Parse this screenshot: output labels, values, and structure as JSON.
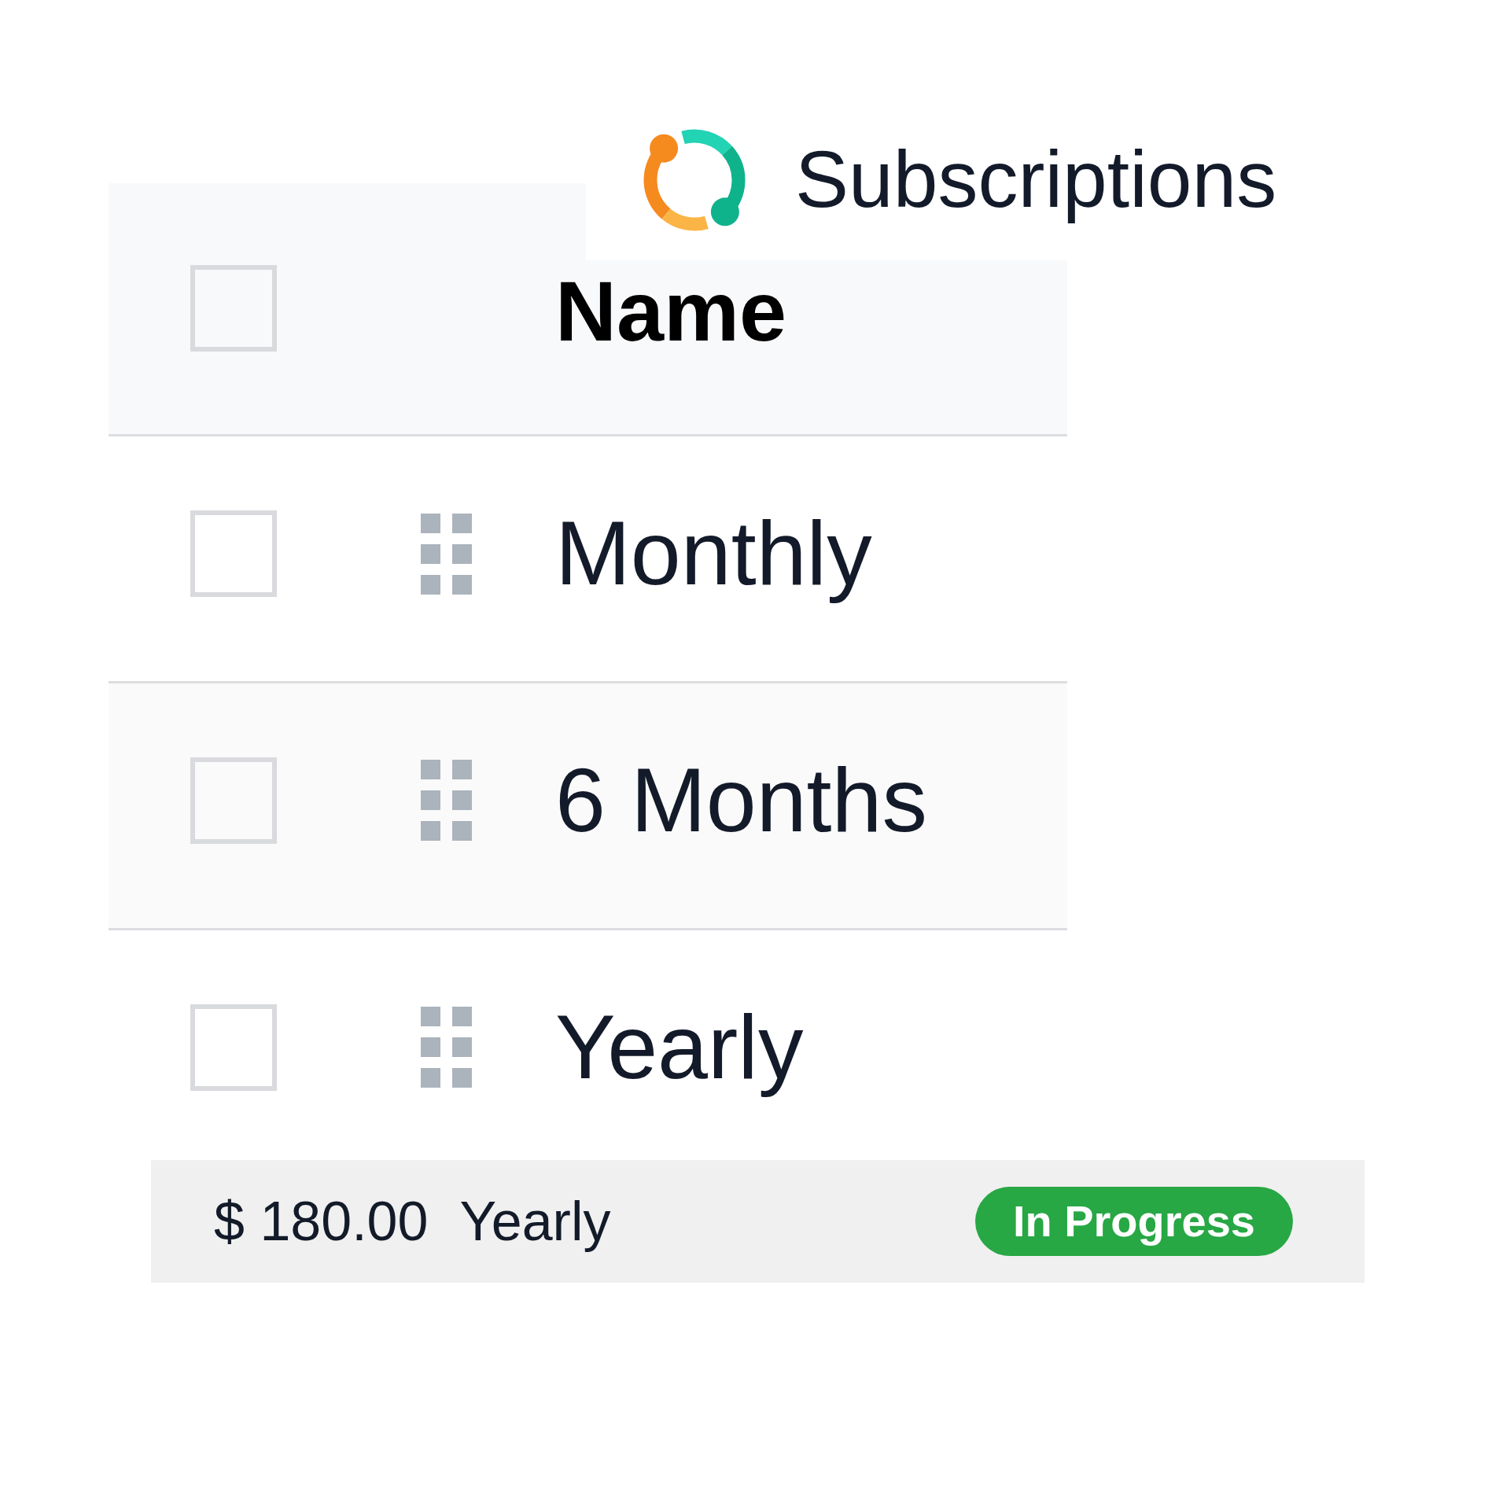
{
  "header": {
    "title": "Subscriptions"
  },
  "table": {
    "select_all": {
      "checked": false
    },
    "columns": [
      {
        "label": "Name"
      }
    ],
    "rows": [
      {
        "name": "Monthly",
        "checked": false
      },
      {
        "name": "6 Months",
        "checked": false
      },
      {
        "name": "Yearly",
        "checked": false
      }
    ]
  },
  "detail_bar": {
    "price": "$ 180.00",
    "period": "Yearly",
    "status": "In Progress"
  }
}
